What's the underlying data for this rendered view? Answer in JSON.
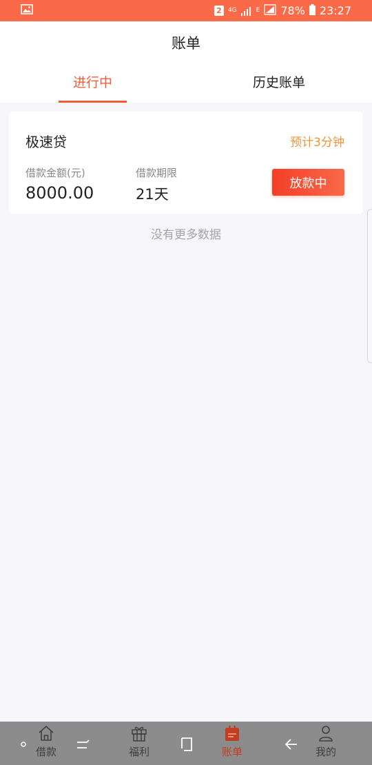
{
  "status_bar": {
    "sim_label": "2",
    "network": "4G",
    "network_sub": "E",
    "battery": "78%",
    "time": "23:27"
  },
  "header": {
    "title": "账单"
  },
  "tabs": [
    {
      "label": "进行中",
      "active": true
    },
    {
      "label": "历史账单",
      "active": false
    }
  ],
  "loan_card": {
    "product_name": "极速贷",
    "eta": "预计3分钟",
    "amount_label": "借款金额(元)",
    "amount_value": "8000.00",
    "term_label": "借款期限",
    "term_value": "21天",
    "status_button": "放款中"
  },
  "no_more_text": "没有更多数据",
  "bottom_nav": [
    {
      "label": "借款",
      "icon": "home-icon",
      "active": false
    },
    {
      "label": "福利",
      "icon": "gift-icon",
      "active": false
    },
    {
      "label": "账单",
      "icon": "bill-icon",
      "active": true
    },
    {
      "label": "我的",
      "icon": "user-icon",
      "active": false
    }
  ],
  "colors": {
    "accent": "#f15b36",
    "status_bar": "#fa6a48",
    "eta": "#f0943a",
    "nav_bar": "#8c8c8c"
  }
}
